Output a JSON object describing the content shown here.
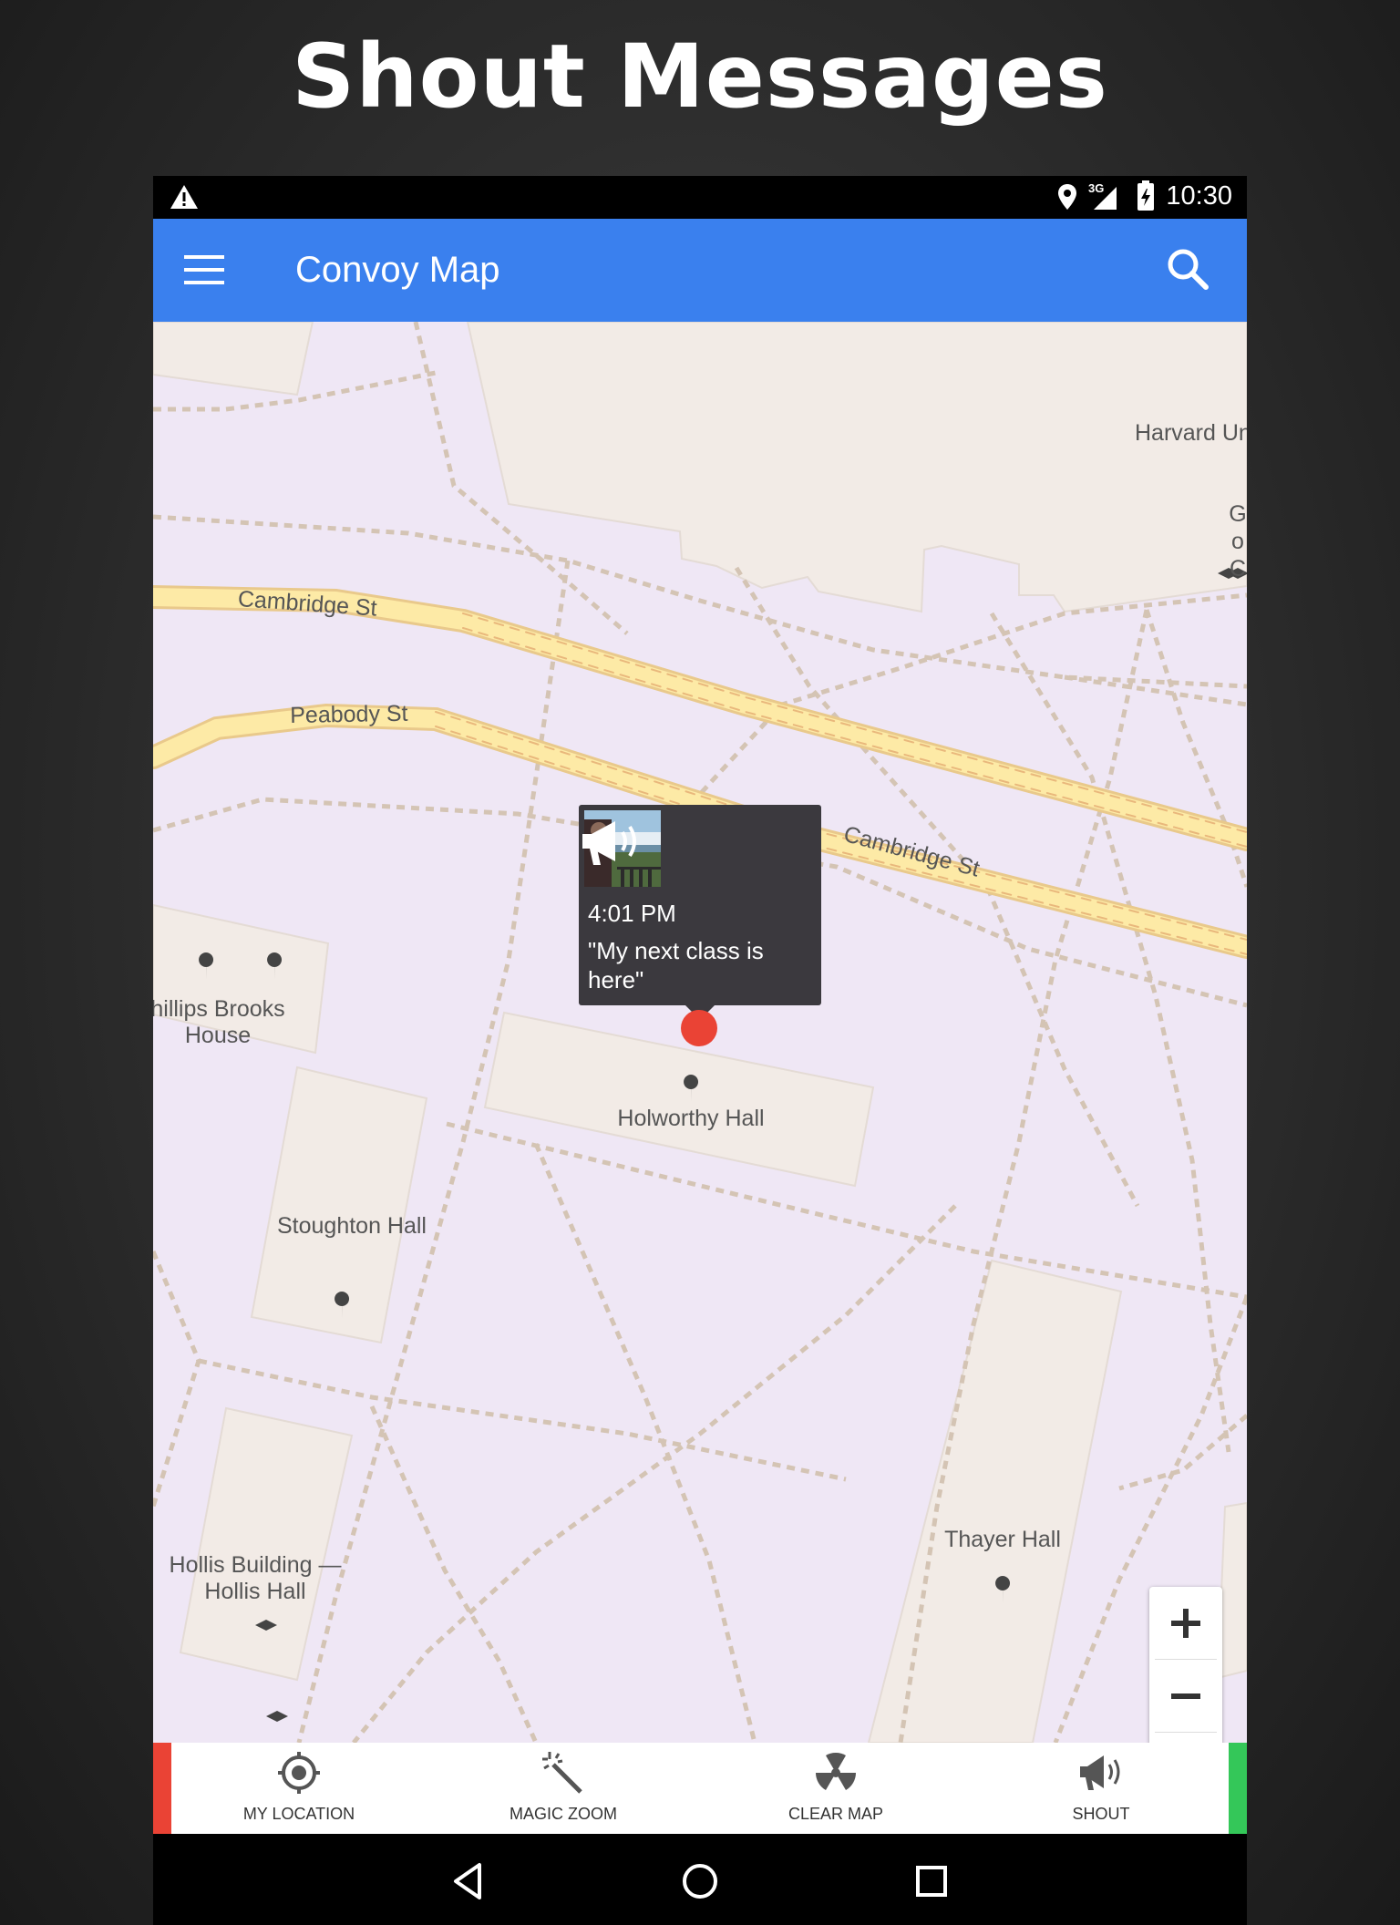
{
  "headline": "Shout Messages",
  "status_bar": {
    "time": "10:30",
    "network": "3G",
    "icons": [
      "warning-icon",
      "location-icon",
      "signal-icon",
      "battery-icon"
    ]
  },
  "app_bar": {
    "title": "Convoy Map",
    "color": "#3a80ee",
    "menu_icon": "hamburger-menu-icon",
    "search_icon": "search-icon"
  },
  "map": {
    "streets": [
      "Cambridge St",
      "Peabody St",
      "Cambridge St"
    ],
    "places": [
      "Harvard Un",
      "Go C",
      "hillips Brooks House",
      "Holworthy Hall",
      "Stoughton Hall",
      "Hollis Building — Hollis Hall",
      "Thayer Hall"
    ]
  },
  "info_window": {
    "time": "4:01 PM",
    "message": "\"My next class is here\"",
    "icon": "megaphone-icon"
  },
  "zoom_controls": {
    "zoom_in": "+",
    "zoom_out": "−"
  },
  "bottom_nav": {
    "items": [
      {
        "label": "MY LOCATION",
        "icon": "crosshair-icon"
      },
      {
        "label": "MAGIC ZOOM",
        "icon": "magic-wand-icon"
      },
      {
        "label": "CLEAR MAP",
        "icon": "radiation-icon"
      },
      {
        "label": "SHOUT",
        "icon": "megaphone-icon"
      }
    ],
    "left_accent": "#ea4335",
    "right_accent": "#34c759"
  },
  "system_nav": [
    "back-icon",
    "home-icon",
    "recents-icon"
  ]
}
